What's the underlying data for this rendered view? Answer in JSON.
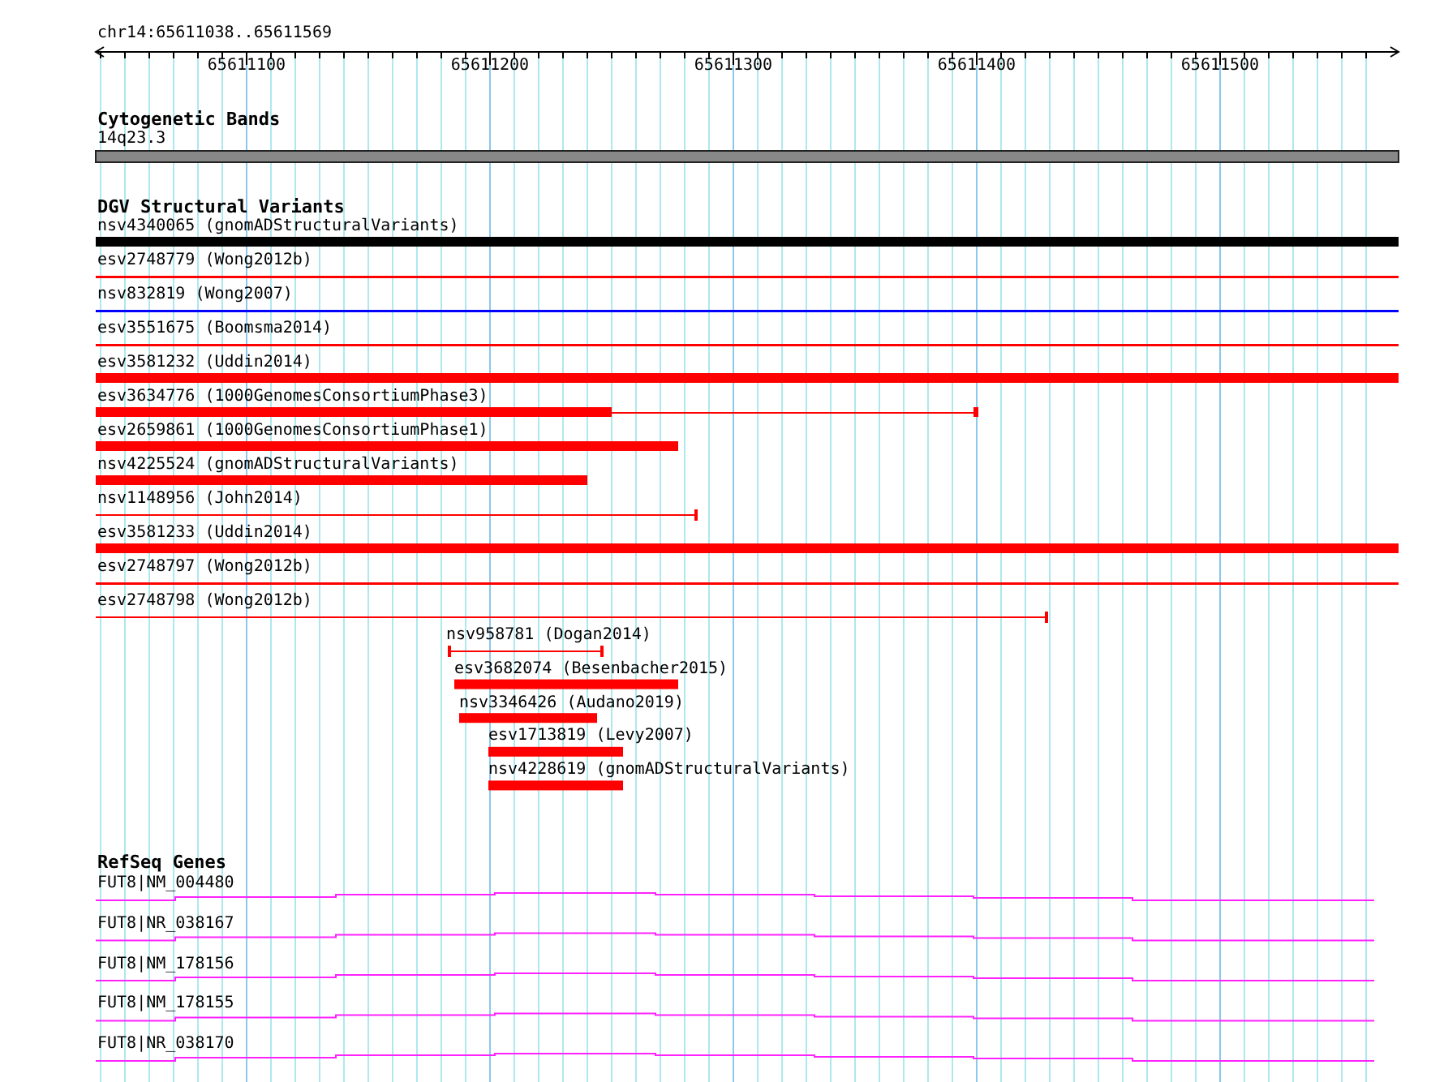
{
  "ruler": {
    "location": "chr14:65611038..65611569",
    "ticks": [
      "65611100",
      "65611200",
      "65611300",
      "65611400",
      "65611500"
    ]
  },
  "tracks": [
    {
      "title": "Cytogenetic Bands",
      "kind": "cytoband",
      "features": [
        {
          "label": "14q23.3"
        }
      ]
    },
    {
      "title": "DGV Structural Variants",
      "kind": "variants",
      "features": [
        {
          "label": "nsv4340065 (gnomADStructuralVariants)",
          "color": "#000000"
        },
        {
          "label": "esv2748779 (Wong2012b)",
          "color": "#ff0000"
        },
        {
          "label": "nsv832819 (Wong2007)",
          "color": "#0000ff"
        },
        {
          "label": "esv3551675 (Boomsma2014)",
          "color": "#ff0000"
        },
        {
          "label": "esv3581232 (Uddin2014)",
          "color": "#ff0000"
        },
        {
          "label": "esv3634776 (1000GenomesConsortiumPhase3)",
          "color": "#ff0000"
        },
        {
          "label": "esv2659861 (1000GenomesConsortiumPhase1)",
          "color": "#ff0000"
        },
        {
          "label": "nsv4225524 (gnomADStructuralVariants)",
          "color": "#ff0000"
        },
        {
          "label": "nsv1148956 (John2014)",
          "color": "#ff0000"
        },
        {
          "label": "esv3581233 (Uddin2014)",
          "color": "#ff0000"
        },
        {
          "label": "esv2748797 (Wong2012b)",
          "color": "#ff0000"
        },
        {
          "label": "esv2748798 (Wong2012b)",
          "color": "#ff0000"
        },
        {
          "label": "nsv958781 (Dogan2014)",
          "color": "#ff0000"
        },
        {
          "label": "esv3682074 (Besenbacher2015)",
          "color": "#ff0000"
        },
        {
          "label": "nsv3346426 (Audano2019)",
          "color": "#ff0000"
        },
        {
          "label": "esv1713819 (Levy2007)",
          "color": "#ff0000"
        },
        {
          "label": "nsv4228619 (gnomADStructuralVariants)",
          "color": "#ff0000"
        }
      ]
    },
    {
      "title": "RefSeq Genes",
      "kind": "genes",
      "features": [
        {
          "label": "FUT8|NM_004480"
        },
        {
          "label": "FUT8|NR_038167"
        },
        {
          "label": "FUT8|NM_178156"
        },
        {
          "label": "FUT8|NM_178155"
        },
        {
          "label": "FUT8|NR_038170"
        }
      ]
    }
  ]
}
